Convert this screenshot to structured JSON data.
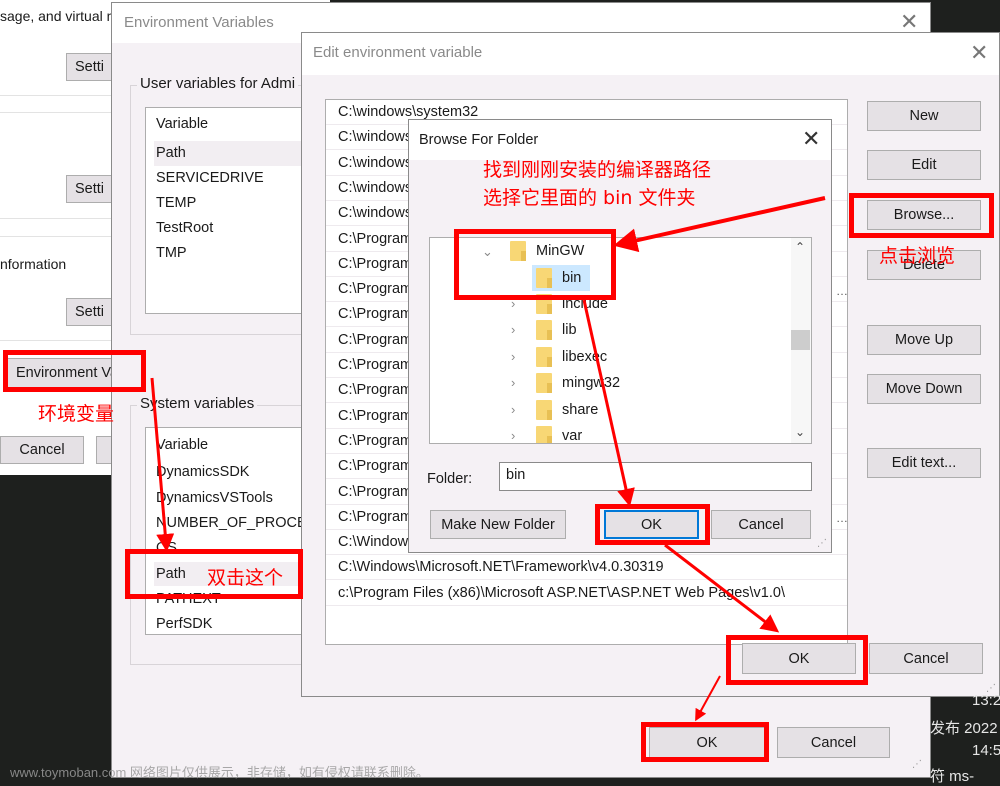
{
  "system_properties": {
    "text_virtual_memory": "sage, and virtual m",
    "settings_label_1": "Setti",
    "settings_label_2": "Setti",
    "text_information": "nformation",
    "settings_label_3": "Setti",
    "env_vars_button": "Environment Va",
    "cancel_button": "Cancel"
  },
  "env_vars_window": {
    "title": "Environment Variables",
    "user_group_label": "User variables for Admi",
    "user_header": "Variable",
    "user_vars": [
      "Path",
      "SERVICEDRIVE",
      "TEMP",
      "TestRoot",
      "TMP"
    ],
    "system_group_label": "System variables",
    "system_header": "Variable",
    "system_vars": [
      "DynamicsSDK",
      "DynamicsVSTools",
      "NUMBER_OF_PROCE",
      "OS",
      "Path",
      "PATHEXT",
      "PerfSDK"
    ],
    "ok_label": "OK",
    "cancel_label": "Cancel"
  },
  "edit_window": {
    "title": "Edit environment variable",
    "paths": [
      "C:\\windows\\system32",
      "C:\\windows",
      "C:\\windows",
      "C:\\windows",
      "C:\\windows",
      "C:\\Program",
      "C:\\Program",
      "C:\\Program",
      "C:\\Program",
      "C:\\Program",
      "C:\\Program",
      "C:\\Program",
      "C:\\Program",
      "C:\\Program",
      "C:\\Program",
      "C:\\Program",
      "C:\\Program",
      "C:\\Windows",
      "C:\\Windows\\Microsoft.NET\\Framework\\v4.0.30319",
      "c:\\Program Files (x86)\\Microsoft ASP.NET\\ASP.NET Web Pages\\v1.0\\"
    ],
    "buttons": {
      "new": "New",
      "edit": "Edit",
      "browse": "Browse...",
      "delete": "Delete",
      "move_up": "Move Up",
      "move_down": "Move Down",
      "edit_text": "Edit text..."
    },
    "ok_label": "OK",
    "cancel_label": "Cancel"
  },
  "browse_dialog": {
    "title": "Browse For Folder",
    "tree": [
      {
        "label": "MinGW",
        "expanded": true,
        "level": 0
      },
      {
        "label": "bin",
        "selected": true,
        "level": 1
      },
      {
        "label": "include",
        "level": 1
      },
      {
        "label": "lib",
        "level": 1
      },
      {
        "label": "libexec",
        "level": 1
      },
      {
        "label": "mingw32",
        "level": 1
      },
      {
        "label": "share",
        "level": 1
      },
      {
        "label": "var",
        "level": 1
      }
    ],
    "folder_label": "Folder:",
    "folder_value": "bin",
    "make_new_folder": "Make New Folder",
    "ok_label": "OK",
    "cancel_label": "Cancel"
  },
  "annotations": {
    "env_vars": "环境变量",
    "double_click": "双击这个",
    "click_browse": "点击浏览",
    "find_path_line1": "找到刚刚安装的编译器路径",
    "find_path_line2": "选择它里面的 bin 文件夹"
  },
  "taskbar_fragments": [
    "13:2",
    "发布  2022",
    "14:5",
    "符   ms-"
  ],
  "watermark": "www.toymoban.com 网络图片仅供展示，非存储，如有侵权请联系删除。",
  "colors": {
    "annotation_red": "#ff0000",
    "selection_blue": "#cce8ff",
    "window_bg": "#f5f1f5"
  }
}
